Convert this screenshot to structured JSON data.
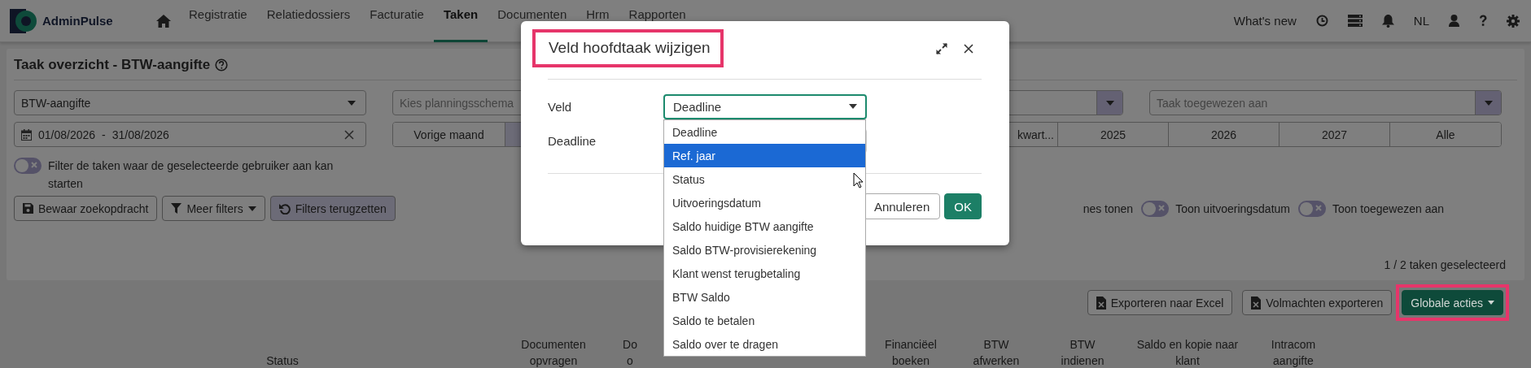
{
  "nav": {
    "logo": "AdminPulse",
    "items": [
      {
        "label": "Registratie",
        "selected": false
      },
      {
        "label": "Relatiedossiers",
        "selected": false
      },
      {
        "label": "Facturatie",
        "selected": false
      },
      {
        "label": "Taken",
        "selected": true
      },
      {
        "label": "Documenten",
        "selected": false
      },
      {
        "label": "Hrm",
        "selected": false
      },
      {
        "label": "Rapporten",
        "selected": false
      }
    ],
    "whats_new": "What's new",
    "language": "NL"
  },
  "filters": {
    "title": "Taak overzicht - BTW-aangifte",
    "task_type": "BTW-aangifte",
    "schedule_placeholder": "Kies planningsschema",
    "assignee_placeholder": "Taak toegewezen aan",
    "date_from": "01/08/2026",
    "date_separator": "-",
    "date_to": "31/08/2026",
    "periods": [
      {
        "label": "Vorige maand"
      },
      {
        "label": "kwart..."
      },
      {
        "label": "2025"
      },
      {
        "label": "2026"
      },
      {
        "label": "2027"
      },
      {
        "label": "Alle"
      }
    ],
    "toggles": [
      {
        "label": "Filter de taken waar de geselecteerde gebruiker aan kan starten",
        "on": false
      },
      {
        "label": "nes tonen"
      },
      {
        "label": "Toon uitvoeringsdatum",
        "on": false
      },
      {
        "label": "Toon toegewezen aan",
        "on": false
      }
    ],
    "buttons": [
      {
        "label": "Bewaar zoekopdracht",
        "kind": "save"
      },
      {
        "label": "Meer filters",
        "kind": "filter"
      },
      {
        "label": "Filters terugzetten",
        "kind": "reset"
      }
    ],
    "selection_count": "1 / 2 taken geselecteerd"
  },
  "actions": [
    {
      "label": "Exporteren naar Excel",
      "kind": "excel",
      "highlighted": false
    },
    {
      "label": "Volmachten exporteren",
      "kind": "excel",
      "highlighted": false
    },
    {
      "label": "Globale acties",
      "kind": "menu",
      "highlighted": true
    }
  ],
  "columns": [
    [
      "Status"
    ],
    [
      "Documenten",
      "opvragen"
    ],
    [
      "Do",
      "o"
    ],
    [
      "Financiëel",
      "boeken"
    ],
    [
      "BTW",
      "afwerken"
    ],
    [
      "BTW",
      "indienen"
    ],
    [
      "Saldo en kopie naar",
      "klant"
    ],
    [
      "Intracom",
      "aangifte"
    ]
  ],
  "modal": {
    "title": "Veld hoofdtaak wijzigen",
    "highlighted": true,
    "fields": [
      {
        "label": "Veld",
        "value": "Deadline"
      },
      {
        "label": "Deadline"
      }
    ],
    "options": [
      {
        "label": "Deadline",
        "selected": false
      },
      {
        "label": "Ref. jaar",
        "selected": true
      },
      {
        "label": "Status",
        "selected": false
      },
      {
        "label": "Uitvoeringsdatum",
        "selected": false
      },
      {
        "label": "Saldo huidige BTW aangifte",
        "selected": false
      },
      {
        "label": "Saldo BTW-provisierekening",
        "selected": false
      },
      {
        "label": "Klant wenst terugbetaling",
        "selected": false
      },
      {
        "label": "BTW Saldo",
        "selected": false
      },
      {
        "label": "Saldo te betalen",
        "selected": false
      },
      {
        "label": "Saldo over te dragen",
        "selected": false
      }
    ],
    "buttons": [
      {
        "label": "Annuleren",
        "kind": "secondary"
      },
      {
        "label": "OK",
        "kind": "primary"
      }
    ]
  }
}
